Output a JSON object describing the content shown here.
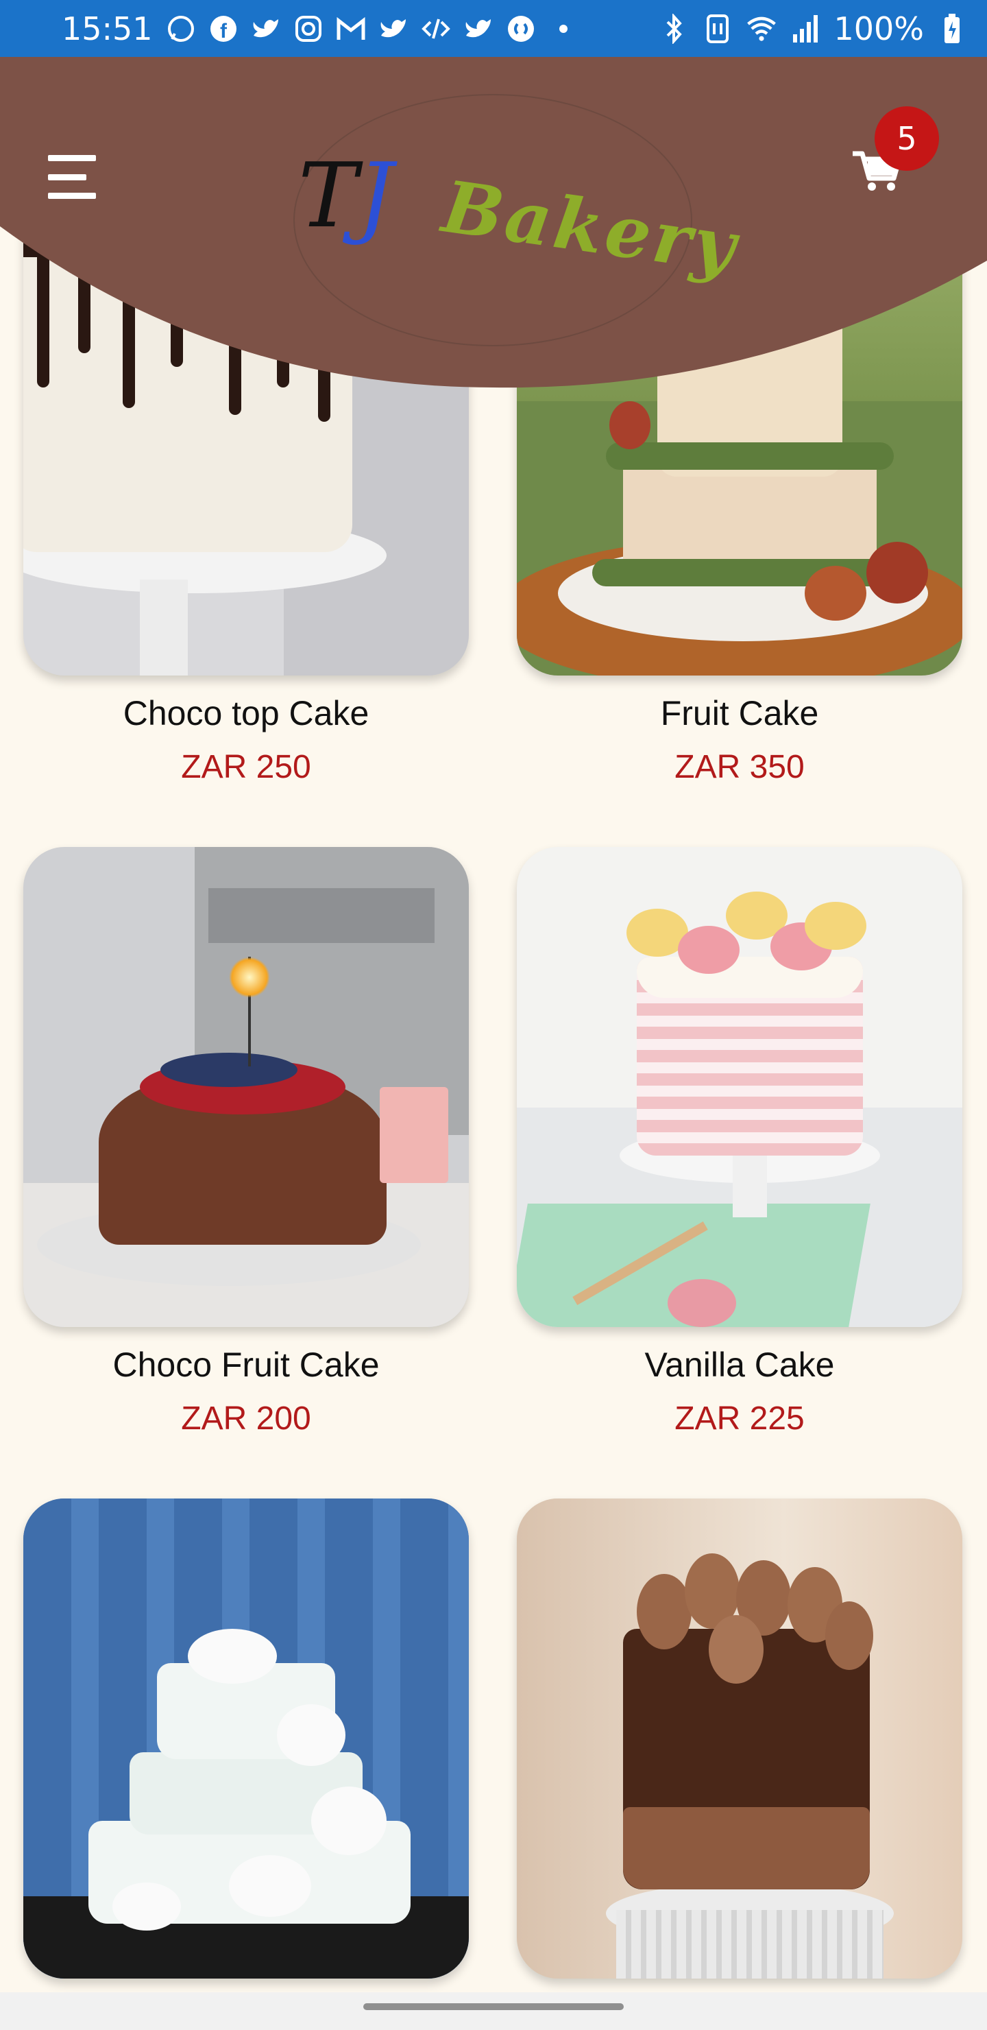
{
  "status_bar": {
    "time": "15:51",
    "battery": "100%",
    "icons": [
      "whatsapp-icon",
      "facebook-icon",
      "twitter-icon",
      "instagram-icon",
      "gmail-icon",
      "twitter-icon",
      "code-icon",
      "twitter-icon",
      "shazam-icon",
      "dot-icon"
    ],
    "right_icons": [
      "bluetooth-icon",
      "nfc-icon",
      "wifi-icon",
      "signal-icon",
      "battery-icon"
    ]
  },
  "header": {
    "logo_t": "T",
    "logo_j": "J",
    "logo_word": "Bakery",
    "cart_count": "5",
    "colors": {
      "header_bg": "#7d5247",
      "badge": "#c51616",
      "price": "#b21a1a"
    }
  },
  "products": [
    {
      "name": "Choco top Cake",
      "price": "ZAR 250"
    },
    {
      "name": "Fruit Cake",
      "price": "ZAR 350"
    },
    {
      "name": "Choco Fruit Cake",
      "price": "ZAR 200"
    },
    {
      "name": "Vanilla Cake",
      "price": "ZAR 225"
    },
    {
      "name": "",
      "price": ""
    },
    {
      "name": "",
      "price": ""
    }
  ]
}
